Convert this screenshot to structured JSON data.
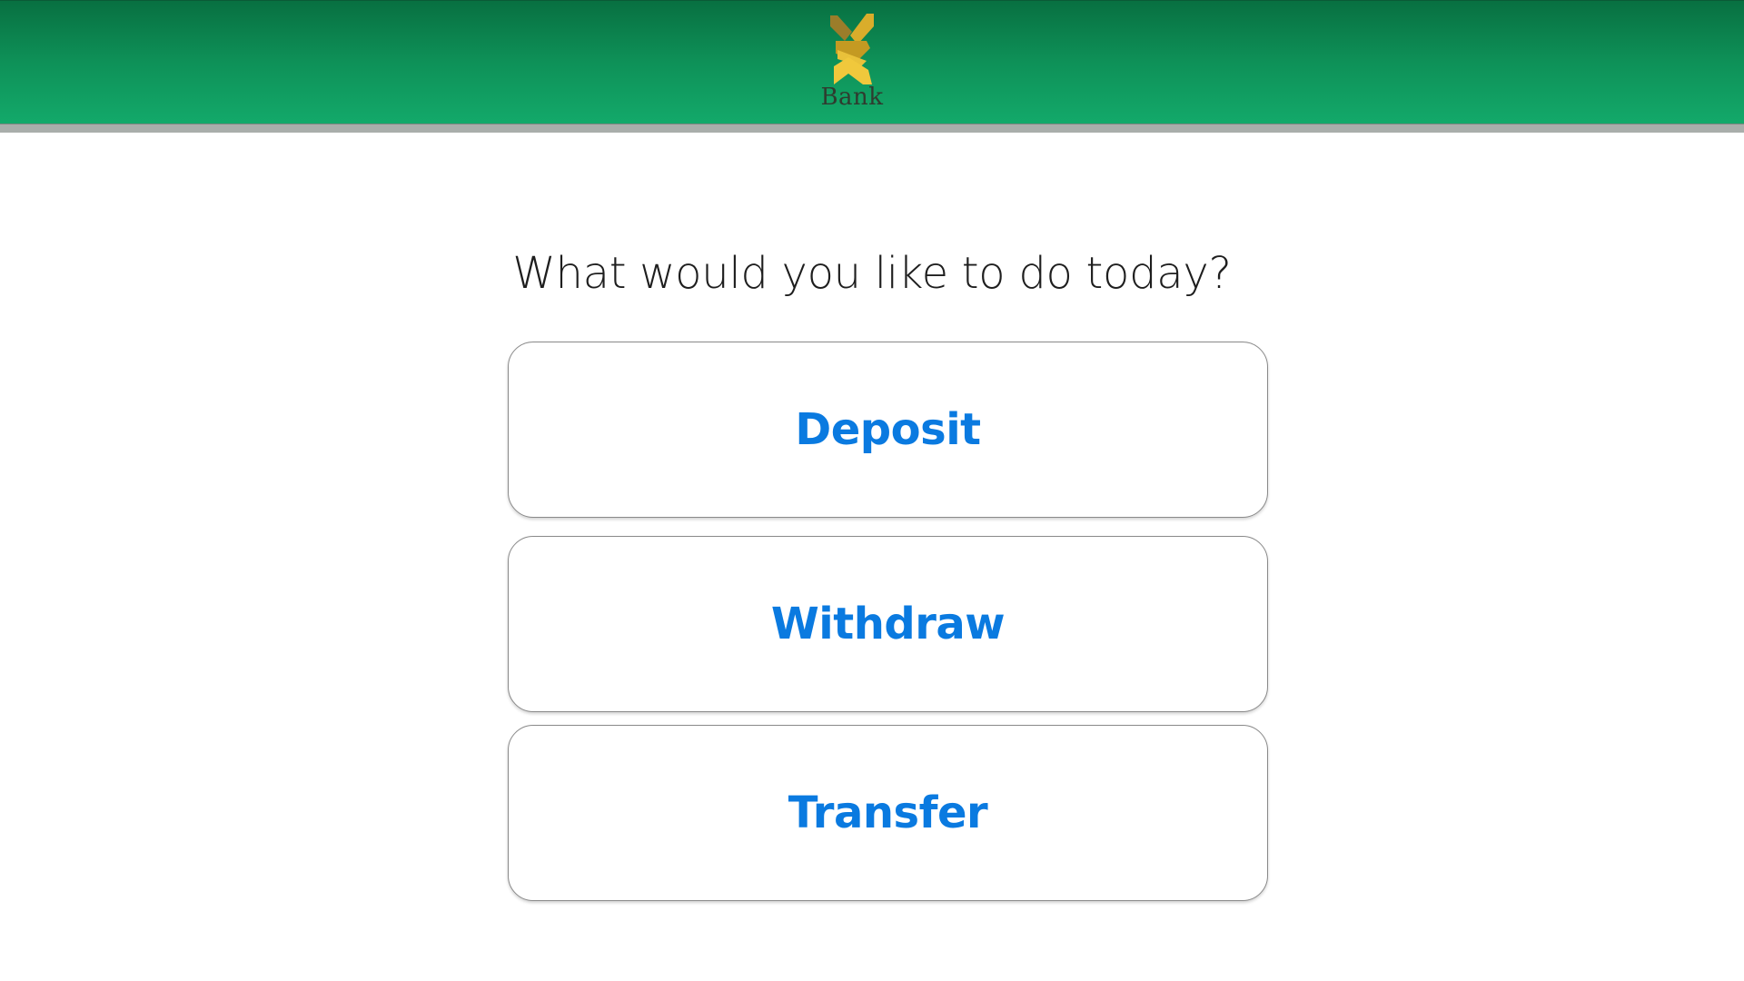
{
  "header": {
    "logo": {
      "icon": "bank-logo-emblem-icon",
      "text": "Bank",
      "colors": [
        "#c49a22",
        "#e9c13a",
        "#9b7d2a"
      ]
    },
    "background_colors": [
      "#087041",
      "#13a96a"
    ]
  },
  "main": {
    "prompt": "What would you like to do today?",
    "options": [
      {
        "label": "Deposit"
      },
      {
        "label": "Withdraw"
      },
      {
        "label": "Transfer"
      }
    ],
    "accent_color": "#0a7ae0"
  }
}
